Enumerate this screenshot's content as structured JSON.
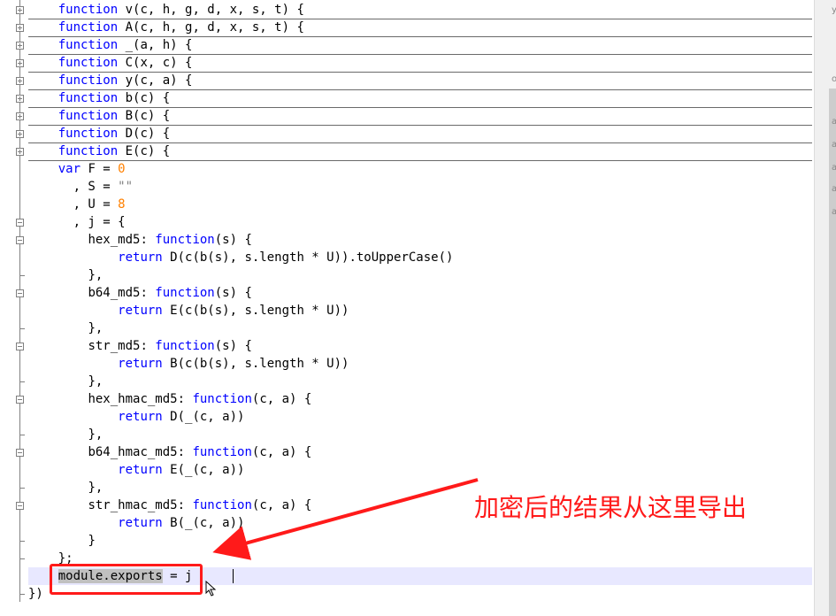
{
  "editor": {
    "lines": [
      {
        "indent": "    ",
        "folded": true,
        "tokens": [
          {
            "t": "kw",
            "v": "function"
          },
          {
            "t": "plain",
            "v": " v(c, h, g, d, x, s, t) {"
          }
        ]
      },
      {
        "indent": "    ",
        "folded": true,
        "tokens": [
          {
            "t": "kw",
            "v": "function"
          },
          {
            "t": "plain",
            "v": " A(c, h, g, d, x, s, t) {"
          }
        ]
      },
      {
        "indent": "    ",
        "folded": true,
        "tokens": [
          {
            "t": "kw",
            "v": "function"
          },
          {
            "t": "plain",
            "v": " _(a, h) {"
          }
        ]
      },
      {
        "indent": "    ",
        "folded": true,
        "tokens": [
          {
            "t": "kw",
            "v": "function"
          },
          {
            "t": "plain",
            "v": " C(x, c) {"
          }
        ]
      },
      {
        "indent": "    ",
        "folded": true,
        "tokens": [
          {
            "t": "kw",
            "v": "function"
          },
          {
            "t": "plain",
            "v": " y(c, a) {"
          }
        ]
      },
      {
        "indent": "    ",
        "folded": true,
        "tokens": [
          {
            "t": "kw",
            "v": "function"
          },
          {
            "t": "plain",
            "v": " b(c) {"
          }
        ]
      },
      {
        "indent": "    ",
        "folded": true,
        "tokens": [
          {
            "t": "kw",
            "v": "function"
          },
          {
            "t": "plain",
            "v": " B(c) {"
          }
        ]
      },
      {
        "indent": "    ",
        "folded": true,
        "tokens": [
          {
            "t": "kw",
            "v": "function"
          },
          {
            "t": "plain",
            "v": " D(c) {"
          }
        ]
      },
      {
        "indent": "    ",
        "folded": true,
        "tokens": [
          {
            "t": "kw",
            "v": "function"
          },
          {
            "t": "plain",
            "v": " E(c) {"
          }
        ]
      },
      {
        "indent": "    ",
        "tokens": [
          {
            "t": "kw",
            "v": "var"
          },
          {
            "t": "plain",
            "v": " F = "
          },
          {
            "t": "num",
            "v": "0"
          }
        ]
      },
      {
        "indent": "      ",
        "tokens": [
          {
            "t": "plain",
            "v": ", S = "
          },
          {
            "t": "str",
            "v": "\"\""
          }
        ]
      },
      {
        "indent": "      ",
        "tokens": [
          {
            "t": "plain",
            "v": ", U = "
          },
          {
            "t": "num",
            "v": "8"
          }
        ]
      },
      {
        "indent": "      ",
        "tokens": [
          {
            "t": "plain",
            "v": ", j = {"
          }
        ]
      },
      {
        "indent": "        ",
        "tokens": [
          {
            "t": "plain",
            "v": "hex_md5: "
          },
          {
            "t": "kw",
            "v": "function"
          },
          {
            "t": "plain",
            "v": "(s) {"
          }
        ]
      },
      {
        "indent": "            ",
        "tokens": [
          {
            "t": "kw",
            "v": "return"
          },
          {
            "t": "plain",
            "v": " D(c(b(s), s.length * U)).toUpperCase()"
          }
        ]
      },
      {
        "indent": "        ",
        "tokens": [
          {
            "t": "plain",
            "v": "},"
          }
        ]
      },
      {
        "indent": "        ",
        "tokens": [
          {
            "t": "plain",
            "v": "b64_md5: "
          },
          {
            "t": "kw",
            "v": "function"
          },
          {
            "t": "plain",
            "v": "(s) {"
          }
        ]
      },
      {
        "indent": "            ",
        "tokens": [
          {
            "t": "kw",
            "v": "return"
          },
          {
            "t": "plain",
            "v": " E(c(b(s), s.length * U))"
          }
        ]
      },
      {
        "indent": "        ",
        "tokens": [
          {
            "t": "plain",
            "v": "},"
          }
        ]
      },
      {
        "indent": "        ",
        "tokens": [
          {
            "t": "plain",
            "v": "str_md5: "
          },
          {
            "t": "kw",
            "v": "function"
          },
          {
            "t": "plain",
            "v": "(s) {"
          }
        ]
      },
      {
        "indent": "            ",
        "tokens": [
          {
            "t": "kw",
            "v": "return"
          },
          {
            "t": "plain",
            "v": " B(c(b(s), s.length * U))"
          }
        ]
      },
      {
        "indent": "        ",
        "tokens": [
          {
            "t": "plain",
            "v": "},"
          }
        ]
      },
      {
        "indent": "        ",
        "tokens": [
          {
            "t": "plain",
            "v": "hex_hmac_md5: "
          },
          {
            "t": "kw",
            "v": "function"
          },
          {
            "t": "plain",
            "v": "(c, a) {"
          }
        ]
      },
      {
        "indent": "            ",
        "tokens": [
          {
            "t": "kw",
            "v": "return"
          },
          {
            "t": "plain",
            "v": " D(_(c, a))"
          }
        ]
      },
      {
        "indent": "        ",
        "tokens": [
          {
            "t": "plain",
            "v": "},"
          }
        ]
      },
      {
        "indent": "        ",
        "tokens": [
          {
            "t": "plain",
            "v": "b64_hmac_md5: "
          },
          {
            "t": "kw",
            "v": "function"
          },
          {
            "t": "plain",
            "v": "(c, a) {"
          }
        ]
      },
      {
        "indent": "            ",
        "tokens": [
          {
            "t": "kw",
            "v": "return"
          },
          {
            "t": "plain",
            "v": " E(_(c, a))"
          }
        ]
      },
      {
        "indent": "        ",
        "tokens": [
          {
            "t": "plain",
            "v": "},"
          }
        ]
      },
      {
        "indent": "        ",
        "tokens": [
          {
            "t": "plain",
            "v": "str_hmac_md5: "
          },
          {
            "t": "kw",
            "v": "function"
          },
          {
            "t": "plain",
            "v": "(c, a) {"
          }
        ]
      },
      {
        "indent": "            ",
        "tokens": [
          {
            "t": "kw",
            "v": "return"
          },
          {
            "t": "plain",
            "v": " B(_(c, a))"
          }
        ]
      },
      {
        "indent": "        ",
        "tokens": [
          {
            "t": "plain",
            "v": "}"
          }
        ]
      },
      {
        "indent": "    ",
        "tokens": [
          {
            "t": "plain",
            "v": "};"
          }
        ]
      },
      {
        "indent": "    ",
        "current": true,
        "tokens": [
          {
            "t": "sel",
            "v": "module.exports"
          },
          {
            "t": "plain",
            "v": " = j"
          }
        ]
      },
      {
        "indent": "",
        "tokens": [
          {
            "t": "plain",
            "v": "})"
          }
        ]
      }
    ]
  },
  "annotation": {
    "text": "加密后的结果从这里导出",
    "color": "#ff1a1a"
  },
  "colors": {
    "keyword": "#0000ff",
    "number": "#ff8000",
    "string": "#808080",
    "current_line": "#e8e8ff",
    "selection": "#c0c0c0"
  },
  "sidebar_fragments": [
    "y",
    "o",
    "a",
    "a",
    "a",
    "a",
    "a"
  ]
}
